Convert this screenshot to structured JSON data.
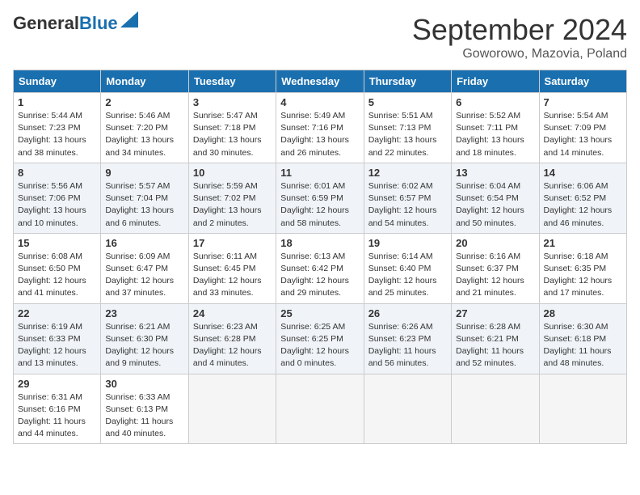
{
  "logo": {
    "general": "General",
    "blue": "Blue"
  },
  "title": {
    "month_year": "September 2024",
    "location": "Goworowo, Mazovia, Poland"
  },
  "weekdays": [
    "Sunday",
    "Monday",
    "Tuesday",
    "Wednesday",
    "Thursday",
    "Friday",
    "Saturday"
  ],
  "weeks": [
    [
      {
        "day": 1,
        "info": "Sunrise: 5:44 AM\nSunset: 7:23 PM\nDaylight: 13 hours\nand 38 minutes."
      },
      {
        "day": 2,
        "info": "Sunrise: 5:46 AM\nSunset: 7:20 PM\nDaylight: 13 hours\nand 34 minutes."
      },
      {
        "day": 3,
        "info": "Sunrise: 5:47 AM\nSunset: 7:18 PM\nDaylight: 13 hours\nand 30 minutes."
      },
      {
        "day": 4,
        "info": "Sunrise: 5:49 AM\nSunset: 7:16 PM\nDaylight: 13 hours\nand 26 minutes."
      },
      {
        "day": 5,
        "info": "Sunrise: 5:51 AM\nSunset: 7:13 PM\nDaylight: 13 hours\nand 22 minutes."
      },
      {
        "day": 6,
        "info": "Sunrise: 5:52 AM\nSunset: 7:11 PM\nDaylight: 13 hours\nand 18 minutes."
      },
      {
        "day": 7,
        "info": "Sunrise: 5:54 AM\nSunset: 7:09 PM\nDaylight: 13 hours\nand 14 minutes."
      }
    ],
    [
      {
        "day": 8,
        "info": "Sunrise: 5:56 AM\nSunset: 7:06 PM\nDaylight: 13 hours\nand 10 minutes."
      },
      {
        "day": 9,
        "info": "Sunrise: 5:57 AM\nSunset: 7:04 PM\nDaylight: 13 hours\nand 6 minutes."
      },
      {
        "day": 10,
        "info": "Sunrise: 5:59 AM\nSunset: 7:02 PM\nDaylight: 13 hours\nand 2 minutes."
      },
      {
        "day": 11,
        "info": "Sunrise: 6:01 AM\nSunset: 6:59 PM\nDaylight: 12 hours\nand 58 minutes."
      },
      {
        "day": 12,
        "info": "Sunrise: 6:02 AM\nSunset: 6:57 PM\nDaylight: 12 hours\nand 54 minutes."
      },
      {
        "day": 13,
        "info": "Sunrise: 6:04 AM\nSunset: 6:54 PM\nDaylight: 12 hours\nand 50 minutes."
      },
      {
        "day": 14,
        "info": "Sunrise: 6:06 AM\nSunset: 6:52 PM\nDaylight: 12 hours\nand 46 minutes."
      }
    ],
    [
      {
        "day": 15,
        "info": "Sunrise: 6:08 AM\nSunset: 6:50 PM\nDaylight: 12 hours\nand 41 minutes."
      },
      {
        "day": 16,
        "info": "Sunrise: 6:09 AM\nSunset: 6:47 PM\nDaylight: 12 hours\nand 37 minutes."
      },
      {
        "day": 17,
        "info": "Sunrise: 6:11 AM\nSunset: 6:45 PM\nDaylight: 12 hours\nand 33 minutes."
      },
      {
        "day": 18,
        "info": "Sunrise: 6:13 AM\nSunset: 6:42 PM\nDaylight: 12 hours\nand 29 minutes."
      },
      {
        "day": 19,
        "info": "Sunrise: 6:14 AM\nSunset: 6:40 PM\nDaylight: 12 hours\nand 25 minutes."
      },
      {
        "day": 20,
        "info": "Sunrise: 6:16 AM\nSunset: 6:37 PM\nDaylight: 12 hours\nand 21 minutes."
      },
      {
        "day": 21,
        "info": "Sunrise: 6:18 AM\nSunset: 6:35 PM\nDaylight: 12 hours\nand 17 minutes."
      }
    ],
    [
      {
        "day": 22,
        "info": "Sunrise: 6:19 AM\nSunset: 6:33 PM\nDaylight: 12 hours\nand 13 minutes."
      },
      {
        "day": 23,
        "info": "Sunrise: 6:21 AM\nSunset: 6:30 PM\nDaylight: 12 hours\nand 9 minutes."
      },
      {
        "day": 24,
        "info": "Sunrise: 6:23 AM\nSunset: 6:28 PM\nDaylight: 12 hours\nand 4 minutes."
      },
      {
        "day": 25,
        "info": "Sunrise: 6:25 AM\nSunset: 6:25 PM\nDaylight: 12 hours\nand 0 minutes."
      },
      {
        "day": 26,
        "info": "Sunrise: 6:26 AM\nSunset: 6:23 PM\nDaylight: 11 hours\nand 56 minutes."
      },
      {
        "day": 27,
        "info": "Sunrise: 6:28 AM\nSunset: 6:21 PM\nDaylight: 11 hours\nand 52 minutes."
      },
      {
        "day": 28,
        "info": "Sunrise: 6:30 AM\nSunset: 6:18 PM\nDaylight: 11 hours\nand 48 minutes."
      }
    ],
    [
      {
        "day": 29,
        "info": "Sunrise: 6:31 AM\nSunset: 6:16 PM\nDaylight: 11 hours\nand 44 minutes."
      },
      {
        "day": 30,
        "info": "Sunrise: 6:33 AM\nSunset: 6:13 PM\nDaylight: 11 hours\nand 40 minutes."
      },
      null,
      null,
      null,
      null,
      null
    ]
  ]
}
